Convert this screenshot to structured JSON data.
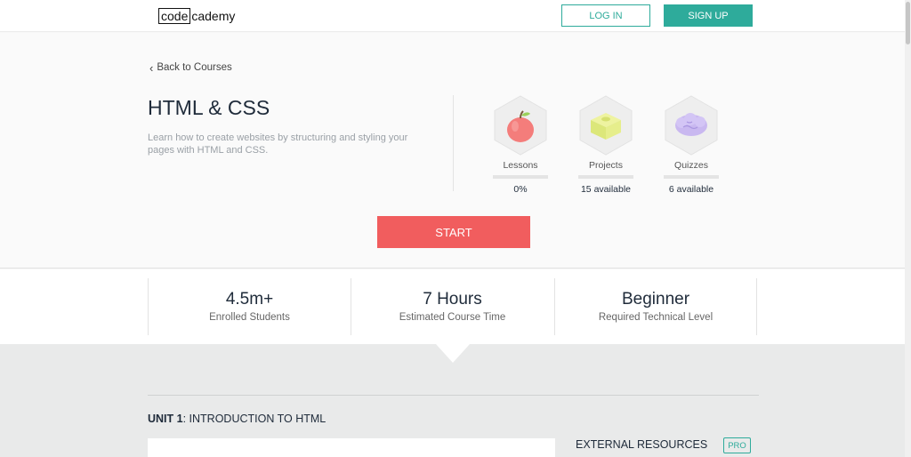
{
  "header": {
    "logo_boxed": "code",
    "logo_rest": "cademy",
    "login_label": "LOG IN",
    "signup_label": "SIGN UP"
  },
  "hero": {
    "back_label": "Back to Courses",
    "title": "HTML & CSS",
    "description": "Learn how to create websites by structuring and styling your pages with HTML and CSS.",
    "stats": [
      {
        "label": "Lessons",
        "value": "0%",
        "icon": "apple-icon"
      },
      {
        "label": "Projects",
        "value": "15 available",
        "icon": "block-icon"
      },
      {
        "label": "Quizzes",
        "value": "6 available",
        "icon": "brain-icon"
      }
    ],
    "start_label": "START"
  },
  "metrics": [
    {
      "value": "4.5m+",
      "label": "Enrolled Students"
    },
    {
      "value": "7 Hours",
      "label": "Estimated Course Time"
    },
    {
      "value": "Beginner",
      "label": "Required Technical Level"
    }
  ],
  "syllabus": {
    "unit_prefix": "UNIT 1",
    "unit_title": ": INTRODUCTION TO HTML",
    "external_title": "EXTERNAL RESOURCES",
    "pro_badge": "PRO"
  },
  "colors": {
    "brand_teal": "#2eab9b",
    "start_red": "#f15d5e",
    "text_dark": "#1f2b3a"
  }
}
